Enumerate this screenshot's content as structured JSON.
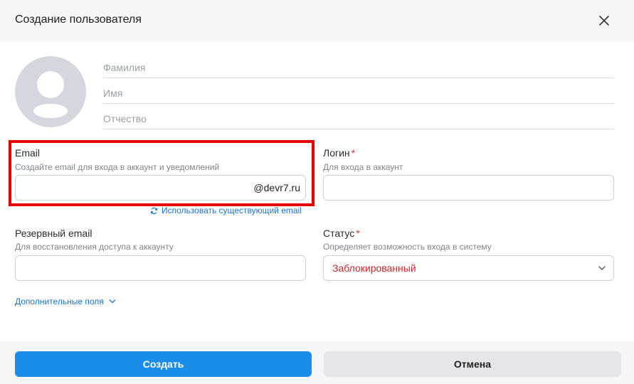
{
  "dialog": {
    "title": "Создание пользователя"
  },
  "name_fields": {
    "last_name_placeholder": "Фамилия",
    "first_name_placeholder": "Имя",
    "middle_name_placeholder": "Отчество"
  },
  "email": {
    "label": "Email",
    "hint": "Создайте email для входа в аккаунт и уведомлений",
    "value": "",
    "domain_suffix": "@devr7.ru",
    "use_existing_link": "Использовать существующий email"
  },
  "login": {
    "label": "Логин",
    "required_mark": "*",
    "hint": "Для входа в аккаунт",
    "value": ""
  },
  "backup_email": {
    "label": "Резервный email",
    "hint": "Для восстановления доступа к аккаунту",
    "value": ""
  },
  "status": {
    "label": "Статус",
    "required_mark": "*",
    "hint": "Определяет возможность входа в систему",
    "selected": "Заблокированный",
    "selected_color": "#c62828"
  },
  "extra_fields": {
    "label": "Дополнительные поля"
  },
  "footer": {
    "create_label": "Создать",
    "cancel_label": "Отмена"
  },
  "colors": {
    "accent": "#1a8cea",
    "highlight": "#e60000",
    "required": "#d9342b"
  },
  "icons": {
    "close": "close-icon",
    "avatar": "user-placeholder-icon",
    "refresh": "refresh-icon",
    "chevron": "chevron-down-icon"
  }
}
